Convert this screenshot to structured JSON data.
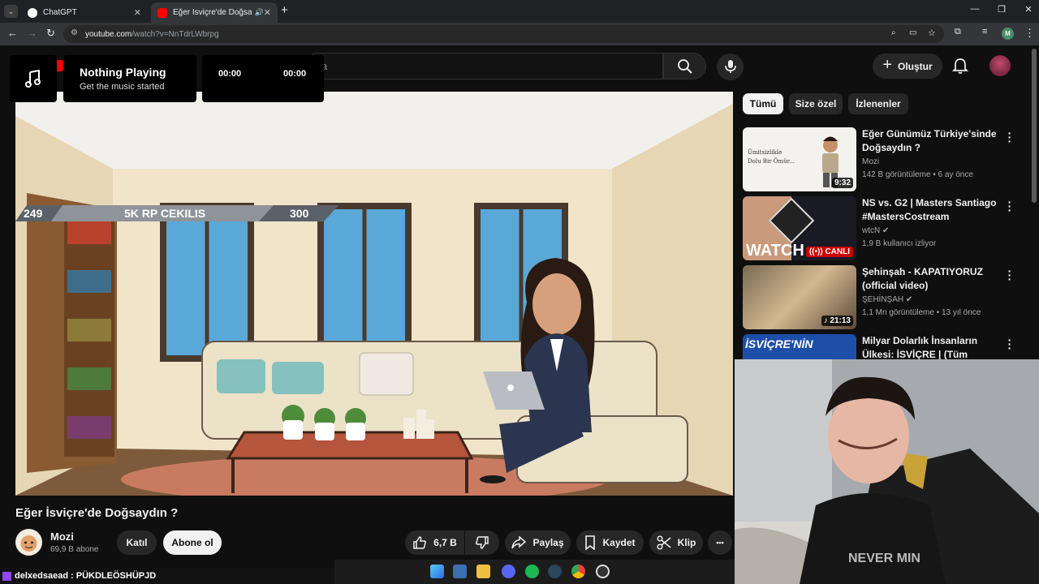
{
  "browser": {
    "tabs": [
      {
        "title": "ChatGPT",
        "active": false
      },
      {
        "title": "Eğer İsviçre'de Doğsaydın ?",
        "active": true
      }
    ],
    "url_host": "youtube.com",
    "url_path": "/watch?v=NnTdrLWbrpg",
    "profile_initial": "M"
  },
  "youtube": {
    "search_placeholder_partial": "a",
    "create_label": "Oluştur"
  },
  "music_widget": {
    "title": "Nothing Playing",
    "subtitle": "Get the music started",
    "time_current": "00:00",
    "time_total": "00:00"
  },
  "video_overlay": {
    "left_number": "249",
    "banner_text": "5K RP CEKILIS",
    "right_number": "300"
  },
  "video": {
    "title": "Eğer İsviçre'de Doğsaydın ?",
    "channel_name": "Mozi",
    "subscribers": "69,9 B abone",
    "join_label": "Katıl",
    "subscribe_label": "Abone ol",
    "likes": "6,7 B",
    "share_label": "Paylaş",
    "save_label": "Kaydet",
    "clip_label": "Klip",
    "more_label": "•••"
  },
  "sidebar": {
    "chips": [
      "Tümü",
      "Size özel",
      "İzlenenler"
    ],
    "recommendations": [
      {
        "title": "Eğer Günümüz Türkiye'sinde Doğsaydın ?",
        "channel": "Mozi",
        "meta": "142 B görüntüleme • 6 ay önce",
        "duration": "9:32",
        "thumb_text": "Ümitsizlikle Dolu Bir Ömür..."
      },
      {
        "title": "NS vs. G2 | Masters Santiago #MastersCostream",
        "channel": "wtcN",
        "meta": "1,9 B kullanıcı izliyor",
        "badge": "CANLI",
        "thumb_text": "WATCH"
      },
      {
        "title": "Şehinşah - KAPATIYORUZ (official video)",
        "channel": "ŞEHİNŞAH",
        "meta": "1,1 Mn görüntüleme • 13 yıl önce",
        "duration": "21:13"
      },
      {
        "title": "Milyar Dolarlık İnsanların Ülkesi: İSVİÇRE | (Tüm Gerçekleriyle!)",
        "thumb_text": "İSVİÇRE'NİN"
      }
    ]
  },
  "overlay_chat": {
    "user": "delxedsaead",
    "message": ": PÜKDLEÖSHÜPJD"
  },
  "colors": {
    "yt_bg": "#0f0f0f",
    "chip_active": "#f1f1f1",
    "live_red": "#cc0000"
  }
}
